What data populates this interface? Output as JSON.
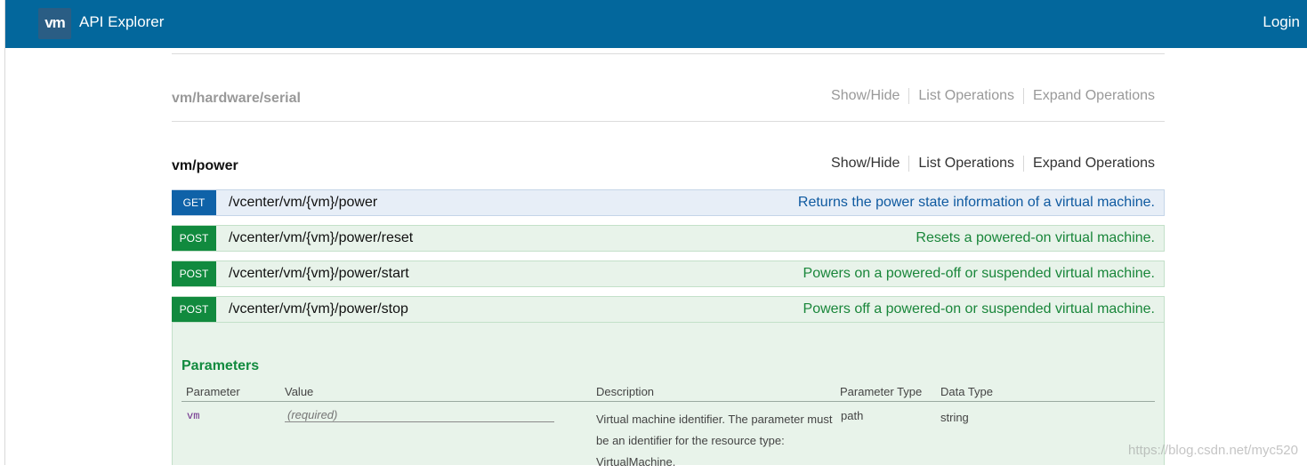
{
  "header": {
    "logo_text": "vm",
    "app_title": "API Explorer",
    "login_label": "Login"
  },
  "resources": [
    {
      "title": "vm/hardware/serial",
      "ops": [
        "Show/Hide",
        "List Operations",
        "Expand Operations"
      ]
    },
    {
      "title": "vm/power",
      "ops": [
        "Show/Hide",
        "List Operations",
        "Expand Operations"
      ]
    }
  ],
  "endpoints": [
    {
      "method": "GET",
      "path": "/vcenter/vm/{vm}/power",
      "summary": "Returns the power state information of a virtual machine."
    },
    {
      "method": "POST",
      "path": "/vcenter/vm/{vm}/power/reset",
      "summary": "Resets a powered-on virtual machine."
    },
    {
      "method": "POST",
      "path": "/vcenter/vm/{vm}/power/start",
      "summary": "Powers on a powered-off or suspended virtual machine."
    },
    {
      "method": "POST",
      "path": "/vcenter/vm/{vm}/power/stop",
      "summary": "Powers off a powered-on or suspended virtual machine."
    }
  ],
  "parameters": {
    "title": "Parameters",
    "headers": {
      "parameter": "Parameter",
      "value": "Value",
      "description": "Description",
      "param_type": "Parameter Type",
      "data_type": "Data Type"
    },
    "rows": [
      {
        "name": "vm",
        "placeholder": "(required)",
        "description": "Virtual machine identifier. The parameter must be an identifier for the resource type: VirtualMachine.",
        "param_type": "path",
        "data_type": "string"
      }
    ]
  },
  "watermark": "https://blog.csdn.net/myc520",
  "colors": {
    "header_bg": "#03679c",
    "get": "#0f62a8",
    "post": "#118a3e"
  }
}
